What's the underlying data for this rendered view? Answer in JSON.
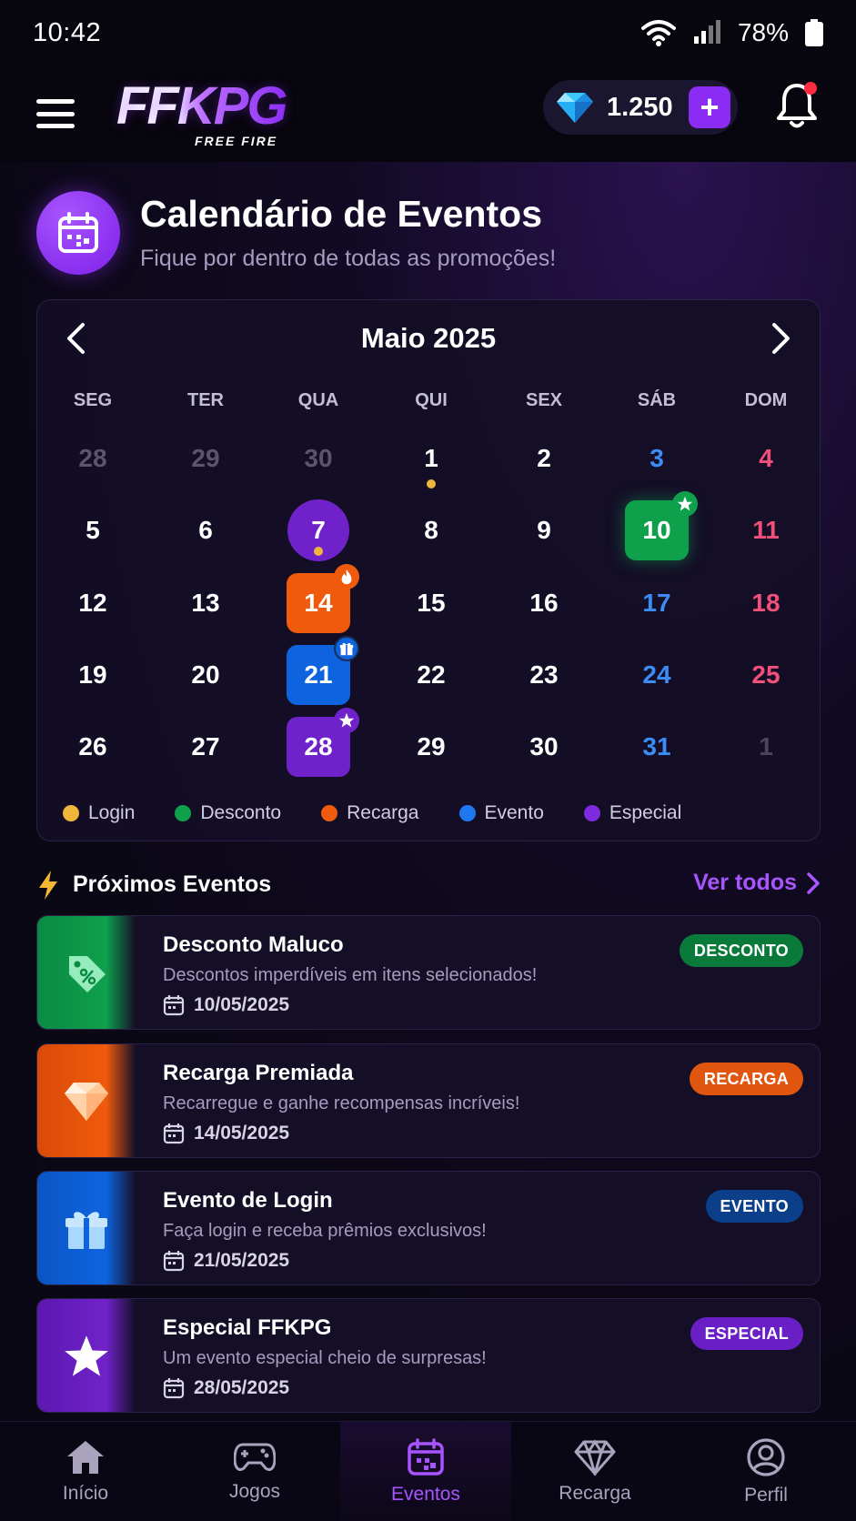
{
  "status_bar": {
    "time": "10:42",
    "battery": "78%"
  },
  "header": {
    "logo_main": "FFKPG",
    "logo_sub": "FREE FIRE",
    "gems": "1.250",
    "add_label": "+"
  },
  "page": {
    "title": "Calendário de Eventos",
    "subtitle": "Fique por dentro de todas as promoções!"
  },
  "calendar": {
    "month": "Maio 2025",
    "weekdays": [
      "SEG",
      "TER",
      "QUA",
      "QUI",
      "SEX",
      "SÁB",
      "DOM"
    ],
    "weeks": [
      [
        "28",
        "29",
        "30",
        "1",
        "2",
        "3",
        "4"
      ],
      [
        "5",
        "6",
        "7",
        "8",
        "9",
        "10",
        "11"
      ],
      [
        "12",
        "13",
        "14",
        "15",
        "16",
        "17",
        "18"
      ],
      [
        "19",
        "20",
        "21",
        "22",
        "23",
        "24",
        "25"
      ],
      [
        "26",
        "27",
        "28",
        "29",
        "30",
        "31",
        "1"
      ]
    ]
  },
  "legend": [
    {
      "label": "Login",
      "color": "#f0b63b"
    },
    {
      "label": "Desconto",
      "color": "#0fa04c"
    },
    {
      "label": "Recarga",
      "color": "#f05a0c"
    },
    {
      "label": "Evento",
      "color": "#1f78f0"
    },
    {
      "label": "Especial",
      "color": "#7d2ae0"
    }
  ],
  "upcoming": {
    "title": "Próximos Eventos",
    "see_all": "Ver todos",
    "events": [
      {
        "title": "Desconto Maluco",
        "desc": "Descontos imperdíveis em itens selecionados!",
        "date": "10/05/2025",
        "tag": "DESCONTO",
        "icon": "discount-tag-icon",
        "color": "#0fa04c"
      },
      {
        "title": "Recarga Premiada",
        "desc": "Recarregue e ganhe recompensas incríveis!",
        "date": "14/05/2025",
        "tag": "RECARGA",
        "icon": "diamond-icon",
        "color": "#f05a0c"
      },
      {
        "title": "Evento de Login",
        "desc": "Faça login e receba prêmios exclusivos!",
        "date": "21/05/2025",
        "tag": "EVENTO",
        "icon": "gift-icon",
        "color": "#0e64df"
      },
      {
        "title": "Especial FFKPG",
        "desc": "Um evento especial cheio de surpresas!",
        "date": "28/05/2025",
        "tag": "ESPECIAL",
        "icon": "star-icon",
        "color": "#6f22c9"
      }
    ]
  },
  "bottom_nav": [
    {
      "label": "Início",
      "icon": "home-icon"
    },
    {
      "label": "Jogos",
      "icon": "gamepad-icon"
    },
    {
      "label": "Eventos",
      "icon": "calendar-icon"
    },
    {
      "label": "Recarga",
      "icon": "diamond-icon"
    },
    {
      "label": "Perfil",
      "icon": "profile-icon"
    }
  ]
}
